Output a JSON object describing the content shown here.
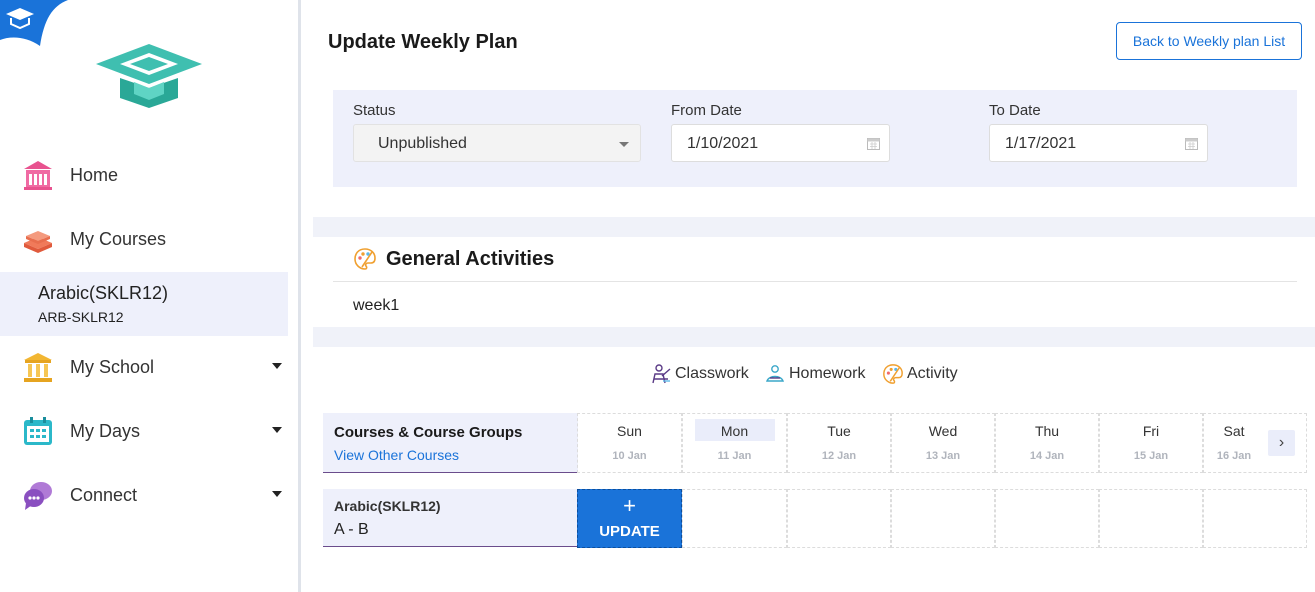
{
  "sidebar": {
    "items": [
      {
        "label": "Home"
      },
      {
        "label": "My Courses"
      },
      {
        "label": "My School"
      },
      {
        "label": "My Days"
      },
      {
        "label": "Connect"
      }
    ],
    "active_course": {
      "title": "Arabic(SKLR12)",
      "code": "ARB-SKLR12"
    }
  },
  "header": {
    "title": "Update Weekly Plan",
    "back_button": "Back to Weekly plan List"
  },
  "filters": {
    "status_label": "Status",
    "status_value": "Unpublished",
    "from_label": "From Date",
    "from_value": "1/10/2021",
    "to_label": "To Date",
    "to_value": "1/17/2021"
  },
  "general": {
    "title": "General Activities",
    "text": "week1"
  },
  "legend": [
    {
      "label": "Classwork",
      "icon": "classwork-icon"
    },
    {
      "label": "Homework",
      "icon": "homework-icon"
    },
    {
      "label": "Activity",
      "icon": "activity-icon"
    }
  ],
  "grid": {
    "header_title": "Courses & Course Groups",
    "header_link": "View Other Courses",
    "days": [
      {
        "name": "Sun",
        "date": "10 Jan"
      },
      {
        "name": "Mon",
        "date": "11 Jan"
      },
      {
        "name": "Tue",
        "date": "12 Jan"
      },
      {
        "name": "Wed",
        "date": "13 Jan"
      },
      {
        "name": "Thu",
        "date": "14 Jan"
      },
      {
        "name": "Fri",
        "date": "15 Jan"
      },
      {
        "name": "Sat",
        "date": "16 Jan"
      }
    ],
    "row": {
      "course": "Arabic(SKLR12)",
      "section": "A - B"
    },
    "update_plus": "+",
    "update_label": "UPDATE",
    "next_arrow": "›"
  },
  "colors": {
    "accent": "#1a73d9",
    "panel": "#eef0fb",
    "teal": "#3fbfb0"
  }
}
